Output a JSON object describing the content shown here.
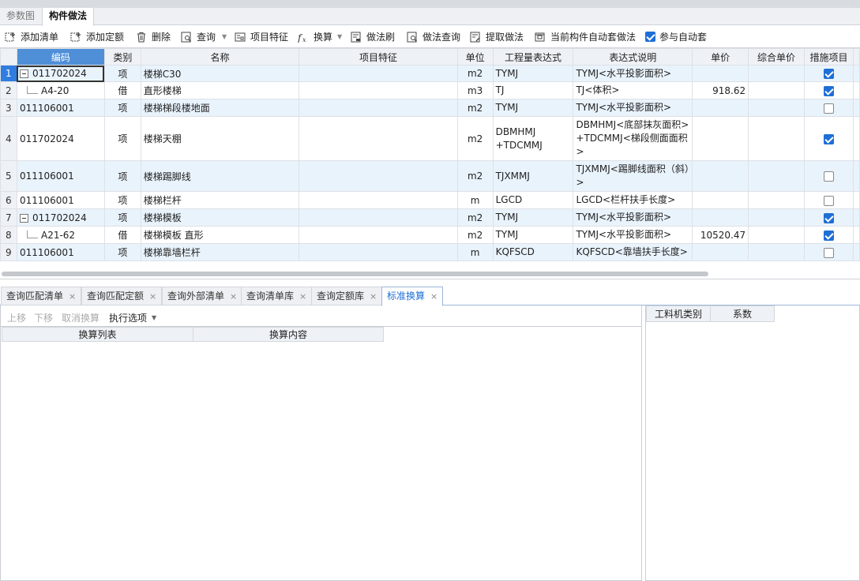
{
  "top_tabs": [
    {
      "label": "参数图",
      "active": false
    },
    {
      "label": "构件做法",
      "active": true
    }
  ],
  "toolbar": {
    "add_list": "添加清单",
    "add_quota": "添加定额",
    "delete": "删除",
    "query": "查询",
    "item_feature": "项目特征",
    "convert": "换算",
    "method_brush": "做法刷",
    "method_query": "做法查询",
    "extract_method": "提取做法",
    "auto_apply": "当前构件自动套做法",
    "participate_auto": "参与自动套",
    "participate_auto_checked": true
  },
  "grid": {
    "headers": [
      "编码",
      "类别",
      "名称",
      "项目特征",
      "单位",
      "工程量表达式",
      "表达式说明",
      "单价",
      "综合单价",
      "措施项目"
    ],
    "rows": [
      {
        "num": "1",
        "code": "011702024",
        "type": "项",
        "name": "楼梯C30",
        "feature": "",
        "unit": "m2",
        "expr": "TYMJ",
        "desc": "TYMJ<水平投影面积>",
        "price": "",
        "total": "",
        "measure": true,
        "child": false,
        "expand": true
      },
      {
        "num": "2",
        "code": "A4-20",
        "type": "借",
        "name": "直形楼梯",
        "feature": "",
        "unit": "m3",
        "expr": "TJ",
        "desc": "TJ<体积>",
        "price": "918.62",
        "total": "",
        "measure": true,
        "child": true,
        "expand": false
      },
      {
        "num": "3",
        "code": "011106001",
        "type": "项",
        "name": "楼梯梯段楼地面",
        "feature": "",
        "unit": "m2",
        "expr": "TYMJ",
        "desc": "TYMJ<水平投影面积>",
        "price": "",
        "total": "",
        "measure": false,
        "child": false,
        "expand": false
      },
      {
        "num": "4",
        "code": "011702024",
        "type": "项",
        "name": "楼梯天棚",
        "feature": "",
        "unit": "m2",
        "expr": "DBMHMJ +TDCMMJ",
        "desc": "DBMHMJ<底部抹灰面积> +TDCMMJ<梯段侧面面积>",
        "price": "",
        "total": "",
        "measure": true,
        "child": false,
        "expand": false
      },
      {
        "num": "5",
        "code": "011106001",
        "type": "项",
        "name": "楼梯踢脚线",
        "feature": "",
        "unit": "m2",
        "expr": "TJXMMJ",
        "desc": "TJXMMJ<踢脚线面积（斜）>",
        "price": "",
        "total": "",
        "measure": false,
        "child": false,
        "expand": false
      },
      {
        "num": "6",
        "code": "011106001",
        "type": "项",
        "name": "楼梯栏杆",
        "feature": "",
        "unit": "m",
        "expr": "LGCD",
        "desc": "LGCD<栏杆扶手长度>",
        "price": "",
        "total": "",
        "measure": false,
        "child": false,
        "expand": false
      },
      {
        "num": "7",
        "code": "011702024",
        "type": "项",
        "name": "楼梯模板",
        "feature": "",
        "unit": "m2",
        "expr": "TYMJ",
        "desc": "TYMJ<水平投影面积>",
        "price": "",
        "total": "",
        "measure": true,
        "child": false,
        "expand": true
      },
      {
        "num": "8",
        "code": "A21-62",
        "type": "借",
        "name": "楼梯模板 直形",
        "feature": "",
        "unit": "m2",
        "expr": "TYMJ",
        "desc": "TYMJ<水平投影面积>",
        "price": "10520.47",
        "total": "",
        "measure": true,
        "child": true,
        "expand": false
      },
      {
        "num": "9",
        "code": "011106001",
        "type": "项",
        "name": "楼梯靠墙栏杆",
        "feature": "",
        "unit": "m",
        "expr": "KQFSCD",
        "desc": "KQFSCD<靠墙扶手长度>",
        "price": "",
        "total": "",
        "measure": false,
        "child": false,
        "expand": false
      }
    ]
  },
  "bottom_tabs": [
    {
      "label": "查询匹配清单",
      "active": false
    },
    {
      "label": "查询匹配定额",
      "active": false
    },
    {
      "label": "查询外部清单",
      "active": false
    },
    {
      "label": "查询清单库",
      "active": false
    },
    {
      "label": "查询定额库",
      "active": false
    },
    {
      "label": "标准换算",
      "active": true
    }
  ],
  "bottom_left": {
    "move_up": "上移",
    "move_down": "下移",
    "cancel_convert": "取消换算",
    "exec_options": "执行选项",
    "col_list": "换算列表",
    "col_content": "换算内容"
  },
  "bottom_right": {
    "col_category": "工料机类别",
    "col_coefficient": "系数"
  },
  "colors": {
    "accent": "#1e6fd6",
    "header_selected": "#4f8fd8",
    "row_alt": "#e9f3fc"
  }
}
